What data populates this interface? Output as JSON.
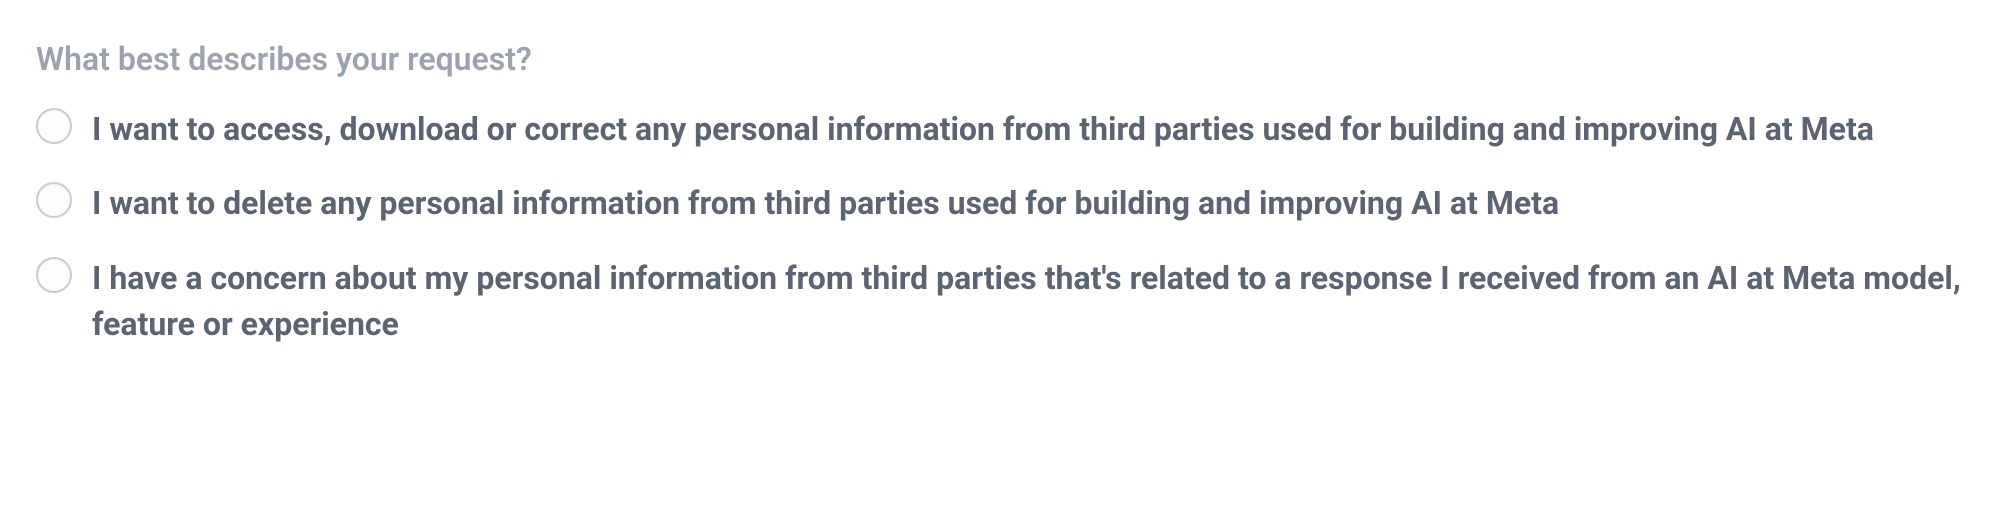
{
  "form": {
    "question": "What best describes your request?",
    "options": [
      {
        "label": "I want to access, download or correct any personal information from third parties used for building and improving AI at Meta"
      },
      {
        "label": "I want to delete any personal information from third parties used for building and improving AI at Meta"
      },
      {
        "label": "I have a concern about my personal information from third parties that's related to a response I received from an AI at Meta model, feature or experience"
      }
    ]
  }
}
